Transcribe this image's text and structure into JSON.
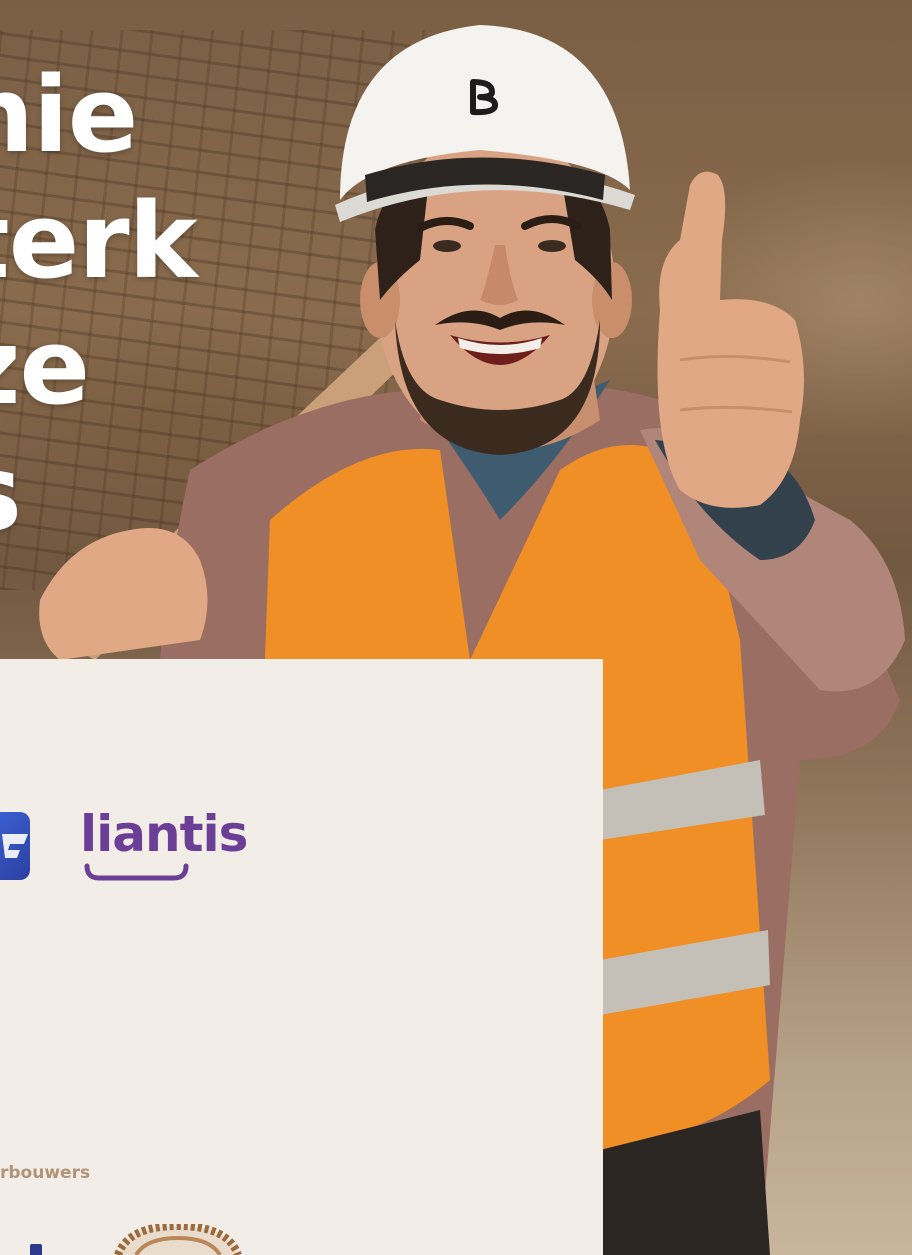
{
  "headline": {
    "lines": [
      "nie",
      "terk",
      "ze",
      "s"
    ]
  },
  "card": {
    "logo_text": "liantis",
    "caption": "rbouwers"
  },
  "colors": {
    "card_background": "#f2ede7",
    "liantis_purple": "#6b3f96",
    "caption_tan": "#b19478",
    "vest_orange": "#f08f25",
    "logo_blue": "#3a5fd0"
  },
  "icons": {
    "helmet_emblem": "b-logo-icon",
    "partial_logo": "blue-logo-icon",
    "seal": "wood-seal-icon"
  }
}
